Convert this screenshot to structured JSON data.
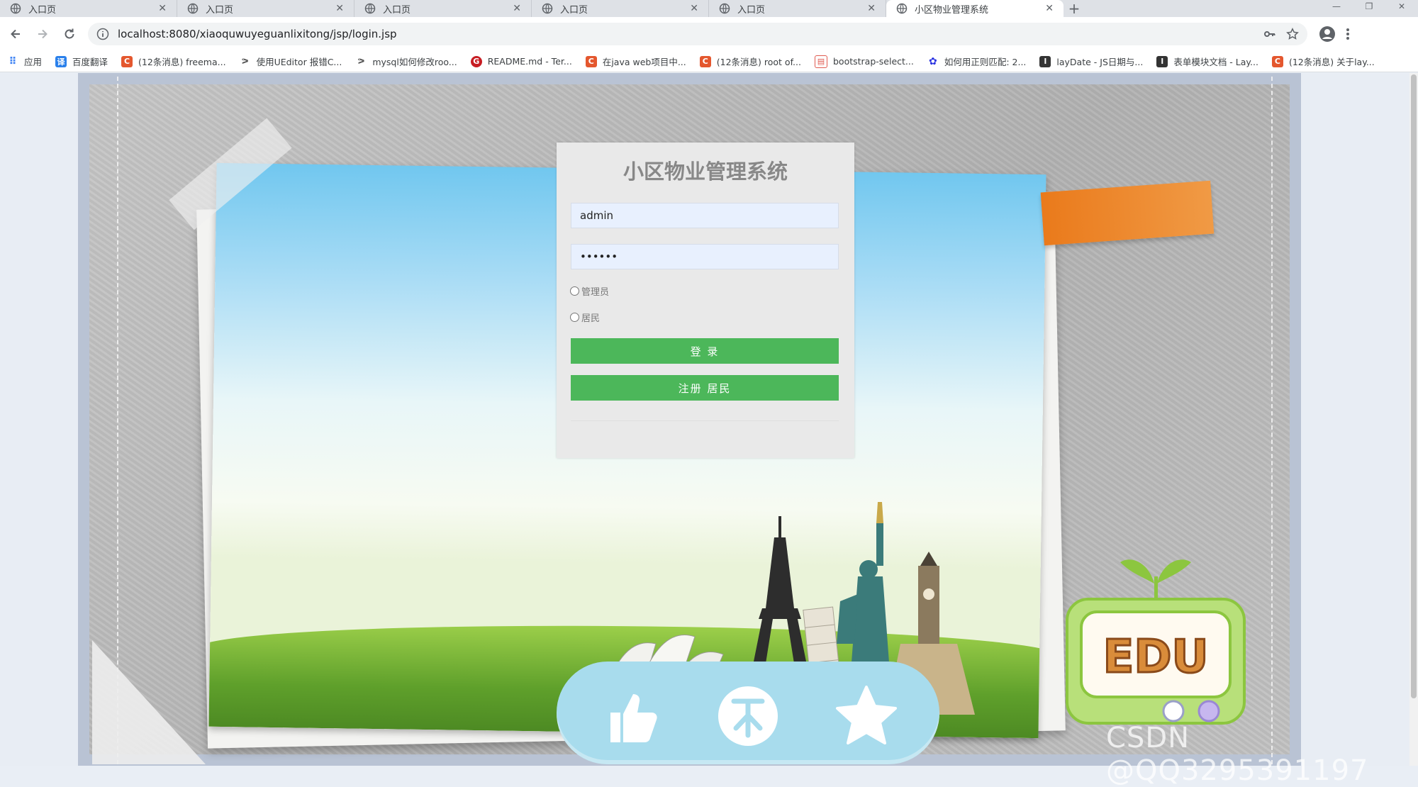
{
  "browser": {
    "tabs": [
      {
        "title": "入口页",
        "active": false
      },
      {
        "title": "入口页",
        "active": false
      },
      {
        "title": "入口页",
        "active": false
      },
      {
        "title": "入口页",
        "active": false
      },
      {
        "title": "入口页",
        "active": false
      },
      {
        "title": "小区物业管理系统",
        "active": true
      }
    ],
    "new_tab_icon": "plus-icon",
    "url": "localhost:8080/xiaoquwuyeguanlixitong/jsp/login.jsp",
    "bookmarks": [
      {
        "label": "应用",
        "icon": "apps-grid-icon",
        "color": "#4285f4"
      },
      {
        "label": "百度翻译",
        "icon": "baidu-translate-icon",
        "color": "#2a80eb"
      },
      {
        "label": "(12条消息) freema...",
        "icon": "csdn-icon",
        "color": "#e4572e"
      },
      {
        "label": "使用UEditor 报错C...",
        "icon": "spark-icon",
        "color": "#555555"
      },
      {
        "label": "mysql如何修改roo...",
        "icon": "spark-icon",
        "color": "#555555"
      },
      {
        "label": "README.md - Ter...",
        "icon": "gitee-icon",
        "color": "#c71d23"
      },
      {
        "label": "在java web项目中...",
        "icon": "csdn-icon",
        "color": "#e4572e"
      },
      {
        "label": "(12条消息) root of...",
        "icon": "csdn-icon",
        "color": "#e4572e"
      },
      {
        "label": "bootstrap-select...",
        "icon": "page-icon",
        "color": "#e05a4f"
      },
      {
        "label": "如何用正则匹配: 2...",
        "icon": "baidu-icon",
        "color": "#2932e1"
      },
      {
        "label": "layDate - JS日期与...",
        "icon": "layui-icon",
        "color": "#333333"
      },
      {
        "label": "表单模块文档 - Lay...",
        "icon": "layui-icon",
        "color": "#333333"
      },
      {
        "label": "(12条消息) 关于lay...",
        "icon": "csdn-icon",
        "color": "#e4572e"
      }
    ]
  },
  "login": {
    "title": "小区物业管理系统",
    "username_value": "admin",
    "password_value": "••••••",
    "role_options": [
      "管理员",
      "居民"
    ],
    "login_button": "登 录",
    "register_button": "注册 居民"
  },
  "decor": {
    "bottom_bar_icons": [
      "thumbs-up-icon",
      "currency-icon",
      "star-icon"
    ],
    "tv_text": "EDU",
    "watermark": "CSDN @QQ3295391197"
  },
  "colors": {
    "button_green": "#4cb75a",
    "orange_tag": "#ea7a1b",
    "bottom_bar": "#a8dced"
  }
}
